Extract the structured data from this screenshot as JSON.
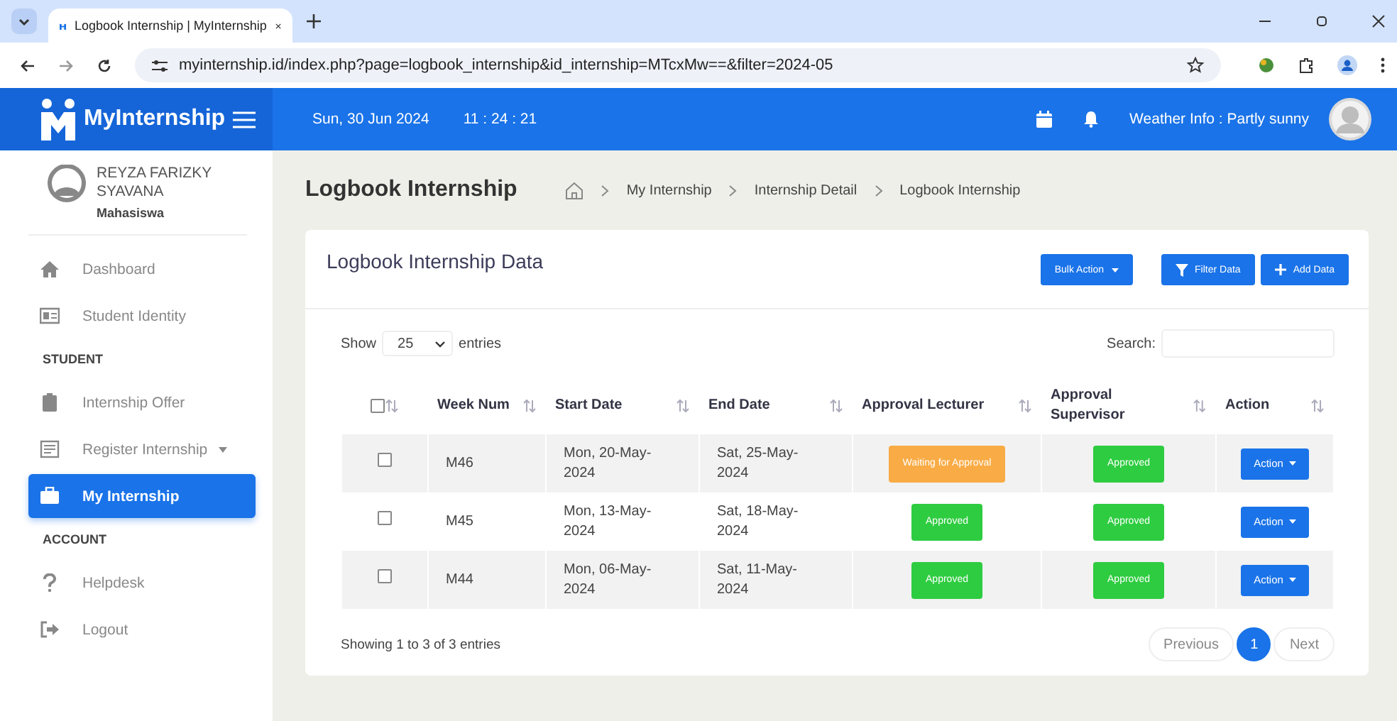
{
  "browser": {
    "tab_title": "Logbook Internship | MyInternship",
    "url": "myinternship.id/index.php?page=logbook_internship&id_internship=MTcxMw==&filter=2024-05"
  },
  "header": {
    "brand": "MyInternship",
    "date": "Sun, 30 Jun 2024",
    "time": "11 : 24 : 21",
    "weather": "Weather Info : Partly sunny"
  },
  "user": {
    "name": "REYZA FARIZKY SYAVANA",
    "role": "Mahasiswa"
  },
  "sidebar": [
    {
      "kind": "link",
      "label": "Dashboard",
      "selected": false,
      "dropdown": false
    },
    {
      "kind": "link",
      "label": "Student Identity",
      "selected": false,
      "dropdown": false
    },
    {
      "kind": "section",
      "label": "STUDENT"
    },
    {
      "kind": "link",
      "label": "Internship Offer",
      "selected": false,
      "dropdown": false
    },
    {
      "kind": "link",
      "label": "Register Internship",
      "selected": false,
      "dropdown": true
    },
    {
      "kind": "link",
      "label": "My Internship",
      "selected": true,
      "dropdown": false
    },
    {
      "kind": "section",
      "label": "ACCOUNT"
    },
    {
      "kind": "link",
      "label": "Helpdesk",
      "selected": false,
      "dropdown": false
    },
    {
      "kind": "link",
      "label": "Logout",
      "selected": false,
      "dropdown": false
    }
  ],
  "page_title": "Logbook Internship",
  "breadcrumbs": [
    "My Internship",
    "Internship Detail",
    "Logbook Internship"
  ],
  "card": {
    "title": "Logbook Internship Data",
    "bulk_action": "Bulk Action",
    "filter": "Filter Data",
    "add": "Add Data"
  },
  "table_controls": {
    "show": "Show",
    "length": "25",
    "entries": "entries",
    "search": "Search:"
  },
  "table": {
    "select_all": {
      "checked": false
    },
    "columns": [
      "Week Num",
      "Start Date",
      "End Date",
      "Approval Lecturer",
      "Approval Supervisor",
      "Action"
    ],
    "rows": [
      {
        "checked": false,
        "week": "M46",
        "start": "Mon, 20-May-2024",
        "end": "Sat, 25-May-2024",
        "lecturer": {
          "label": "Waiting for Approval",
          "kind": "waiting"
        },
        "supervisor": {
          "label": "Approved",
          "kind": "approved"
        },
        "action": "Action"
      },
      {
        "checked": false,
        "week": "M45",
        "start": "Mon, 13-May-2024",
        "end": "Sat, 18-May-2024",
        "lecturer": {
          "label": "Approved",
          "kind": "approved"
        },
        "supervisor": {
          "label": "Approved",
          "kind": "approved"
        },
        "action": "Action"
      },
      {
        "checked": false,
        "week": "M44",
        "start": "Mon, 06-May-2024",
        "end": "Sat, 11-May-2024",
        "lecturer": {
          "label": "Approved",
          "kind": "approved"
        },
        "supervisor": {
          "label": "Approved",
          "kind": "approved"
        },
        "action": "Action"
      }
    ]
  },
  "footer": {
    "info": "Showing 1 to 3 of 3 entries",
    "pages": [
      {
        "label": "Previous",
        "kind": "prev",
        "selected": false
      },
      {
        "label": "1",
        "kind": "page",
        "selected": true
      },
      {
        "label": "Next",
        "kind": "next",
        "selected": false
      }
    ]
  }
}
